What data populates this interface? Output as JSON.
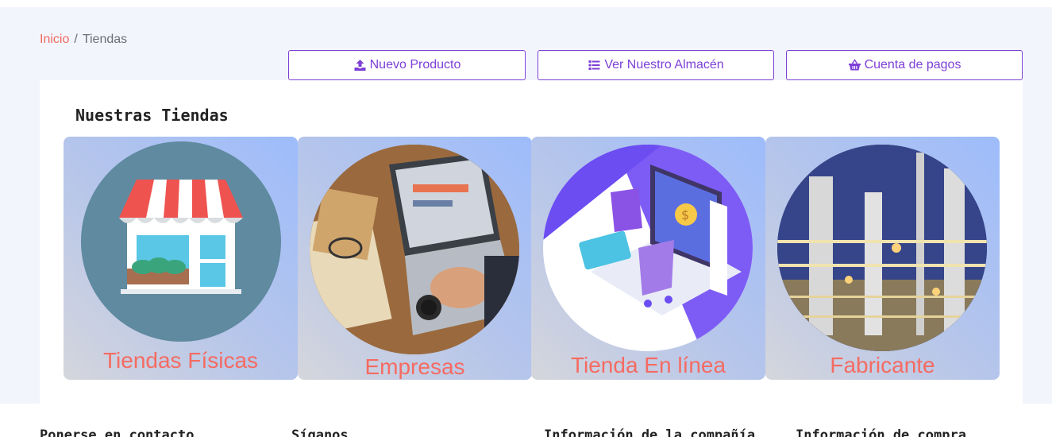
{
  "breadcrumb": {
    "home": "Inicio",
    "separator": "/",
    "current": "Tiendas"
  },
  "actions": [
    {
      "label": "Nuevo Producto",
      "icon": "upload-icon"
    },
    {
      "label": "Ver Nuestro Almacén",
      "icon": "list-icon"
    },
    {
      "label": "Cuenta de pagos",
      "icon": "basket-icon"
    }
  ],
  "section_title": "Nuestras Tiendas",
  "stores": [
    {
      "label": "Tiendas Físicas",
      "image": "storefront-illustration"
    },
    {
      "label": "Empresas",
      "image": "laptop-desk-photo"
    },
    {
      "label": "Tienda En línea",
      "image": "online-shop-illustration"
    },
    {
      "label": "Fabricante",
      "image": "refinery-photo"
    }
  ],
  "footer": {
    "columns": [
      "Ponerse en contacto",
      "Síganos",
      "Información de la compañía",
      "Información de compra"
    ]
  },
  "colors": {
    "accent": "#7e3fd6",
    "link": "#f06a5e",
    "label": "#f56b62",
    "background": "#f3f5fd"
  }
}
